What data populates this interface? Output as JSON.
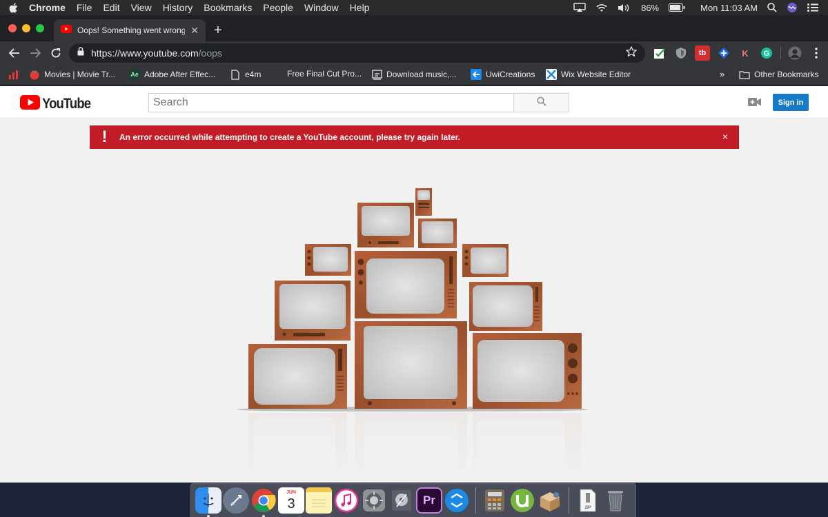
{
  "menubar": {
    "app_name": "Chrome",
    "menus": [
      "File",
      "Edit",
      "View",
      "History",
      "Bookmarks",
      "People",
      "Window",
      "Help"
    ],
    "battery": "86%",
    "clock": "Mon 11:03 AM"
  },
  "browser": {
    "tab_title": "Oops! Something went wrong.",
    "url_host": "https://www.youtube.com",
    "url_path": "/oops",
    "bookmarks": [
      {
        "label": "Movies | Movie Tr..."
      },
      {
        "label": "Adobe After Effec..."
      },
      {
        "label": "e4m"
      },
      {
        "label": "Free Final Cut Pro..."
      },
      {
        "label": "Download music,..."
      },
      {
        "label": "UwiCreations"
      },
      {
        "label": "Wix Website Editor"
      }
    ],
    "bookmarks_overflow": "»",
    "other_bookmarks": "Other Bookmarks"
  },
  "youtube": {
    "logo_text": "YouTube",
    "search_placeholder": "Search",
    "signin_label": "Sign in",
    "alert_message": "An error occurred while attempting to create a YouTube account, please try again later.",
    "alert_icon": "!",
    "alert_close": "×"
  },
  "dock": {
    "calendar_day": "3",
    "calendar_month": "JUN"
  },
  "colors": {
    "youtube_red": "#ff0000",
    "alert_red": "#c21c26",
    "signin_blue": "#167ac6",
    "tv_wood": "#a0522d"
  }
}
